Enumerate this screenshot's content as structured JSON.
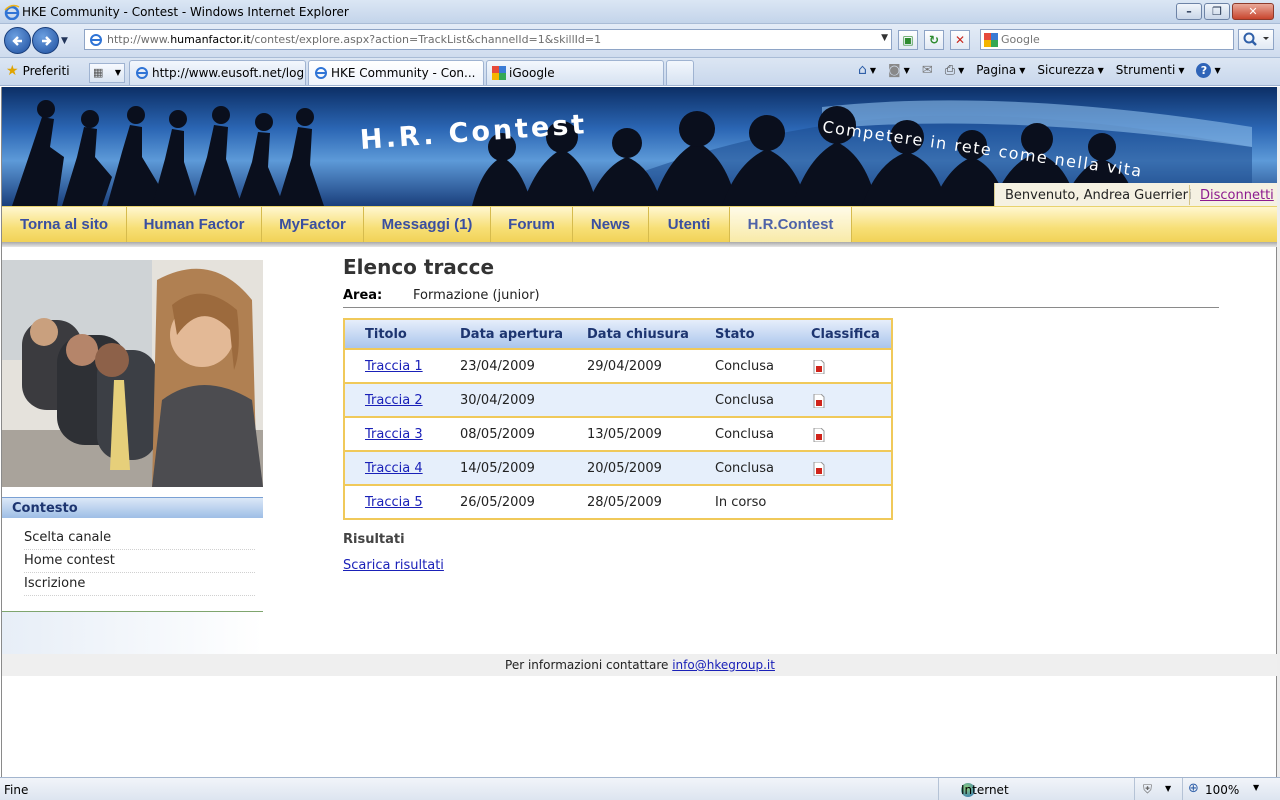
{
  "window": {
    "title": "HKE Community - Contest - Windows Internet Explorer",
    "minimize": "–",
    "restore": "❐",
    "close": "✕"
  },
  "address": {
    "url_prefix": "http://www.",
    "url_host": "humanfactor.it",
    "url_path": "/contest/explore.aspx?action=TrackList&channelId=1&skillId=1"
  },
  "search": {
    "placeholder": "Google"
  },
  "favorites": {
    "label": "Preferiti"
  },
  "tabs": [
    {
      "label": "http://www.eusoft.net/log..."
    },
    {
      "label": "HKE Community - Con..."
    },
    {
      "label": "iGoogle"
    }
  ],
  "commands": {
    "page": "Pagina",
    "security": "Sicurezza",
    "tools": "Strumenti"
  },
  "site": {
    "brand": "H.R. Contest",
    "slogan": "Competere in rete come nella vita",
    "welcome": "Benvenuto, Andrea Guerrieri",
    "logout": "Disconnetti"
  },
  "menu": [
    {
      "label": "Torna al sito"
    },
    {
      "label": "Human Factor"
    },
    {
      "label": "MyFactor"
    },
    {
      "label": "Messaggi (1)"
    },
    {
      "label": "Forum"
    },
    {
      "label": "News"
    },
    {
      "label": "Utenti"
    },
    {
      "label": "H.R.Contest"
    }
  ],
  "sidebar": {
    "heading": "Contesto",
    "items": [
      {
        "label": "Scelta canale"
      },
      {
        "label": "Home contest"
      },
      {
        "label": "Iscrizione"
      }
    ]
  },
  "main": {
    "title": "Elenco tracce",
    "area_label": "Area:",
    "area_value": "Formazione (junior)",
    "columns": [
      "Titolo",
      "Data apertura",
      "Data chiusura",
      "Stato",
      "Classifica"
    ],
    "rows": [
      {
        "title": "Traccia 1",
        "open": "23/04/2009",
        "close": "29/04/2009",
        "status": "Conclusa"
      },
      {
        "title": "Traccia 2",
        "open": "30/04/2009",
        "close": "",
        "status": "Conclusa"
      },
      {
        "title": "Traccia 3",
        "open": "08/05/2009",
        "close": "13/05/2009",
        "status": "Conclusa"
      },
      {
        "title": "Traccia 4",
        "open": "14/05/2009",
        "close": "20/05/2009",
        "status": "Conclusa"
      },
      {
        "title": "Traccia 5",
        "open": "26/05/2009",
        "close": "28/05/2009",
        "status": "In corso"
      }
    ],
    "results_heading": "Risultati",
    "results_link": "Scarica risultati"
  },
  "footer": {
    "text": "Per informazioni contattare",
    "email": "info@hkegroup.it"
  },
  "status": {
    "text": "Fine",
    "zone": "Internet",
    "zoom": "100%"
  },
  "colors": {
    "menu_text": "#3a4fa0",
    "table_border": "#f0c95a",
    "link": "#1a21b8",
    "visited_link": "#8c1a8f"
  }
}
